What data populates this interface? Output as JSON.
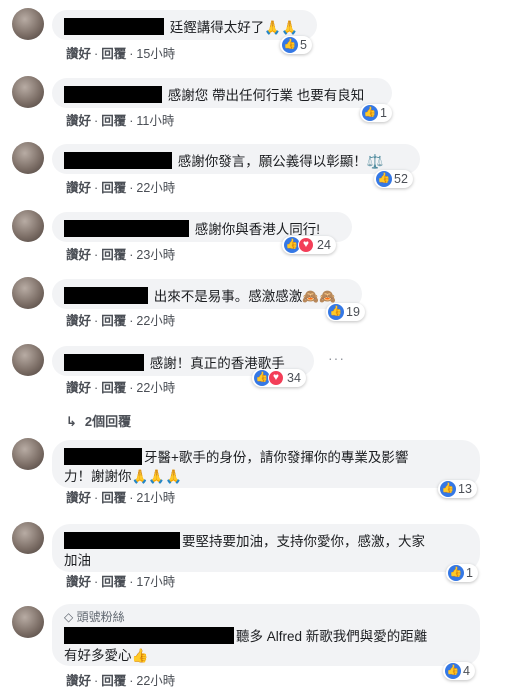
{
  "actions": {
    "like": "讚好",
    "reply": "回覆",
    "sep": "·"
  },
  "comments": [
    {
      "text": "廷鏗講得太好了🙏🙏",
      "time": "15小時",
      "reactions": "5"
    },
    {
      "text": "感謝您 帶出任何行業 也要有良知",
      "time": "11小時",
      "reactions": "1"
    },
    {
      "text": "感謝你發言，願公義得以彰顯！⚖️",
      "time": "22小時",
      "reactions": "52"
    },
    {
      "text": "感謝你與香港人同行!",
      "time": "23小時",
      "reactions": "24"
    },
    {
      "text": "出來不是易事。感激感激🙈🙈",
      "time": "22小時",
      "reactions": "19"
    },
    {
      "text": "感謝！真正的香港歌手",
      "time": "22小時",
      "reactions": "34",
      "replies": "2個回覆"
    },
    {
      "text_line1": "牙醫+歌手的身份，請你發揮你的專業及影響",
      "text_line2": "力！謝謝你🙏🙏🙏",
      "time": "21小時",
      "reactions": "13"
    },
    {
      "text_line1": "要堅持要加油，支持你愛你，感激，大家",
      "text_line2": "加油",
      "time": "17小時",
      "reactions": "1"
    },
    {
      "badge": "頭號粉絲",
      "text_line1": "聽多 Alfred 新歌我們與愛的距離",
      "text_line2": "有好多愛心👍",
      "time": "22小時",
      "reactions": "4"
    }
  ],
  "icons": {
    "like": "like-icon",
    "love": "love-icon",
    "more": "more-options-icon",
    "reply_arrow": "reply-arrow-icon",
    "badge": "diamond-badge-icon"
  },
  "colors": {
    "like": "#3578e5",
    "love": "#f33e58",
    "bubble": "#f2f3f5"
  }
}
